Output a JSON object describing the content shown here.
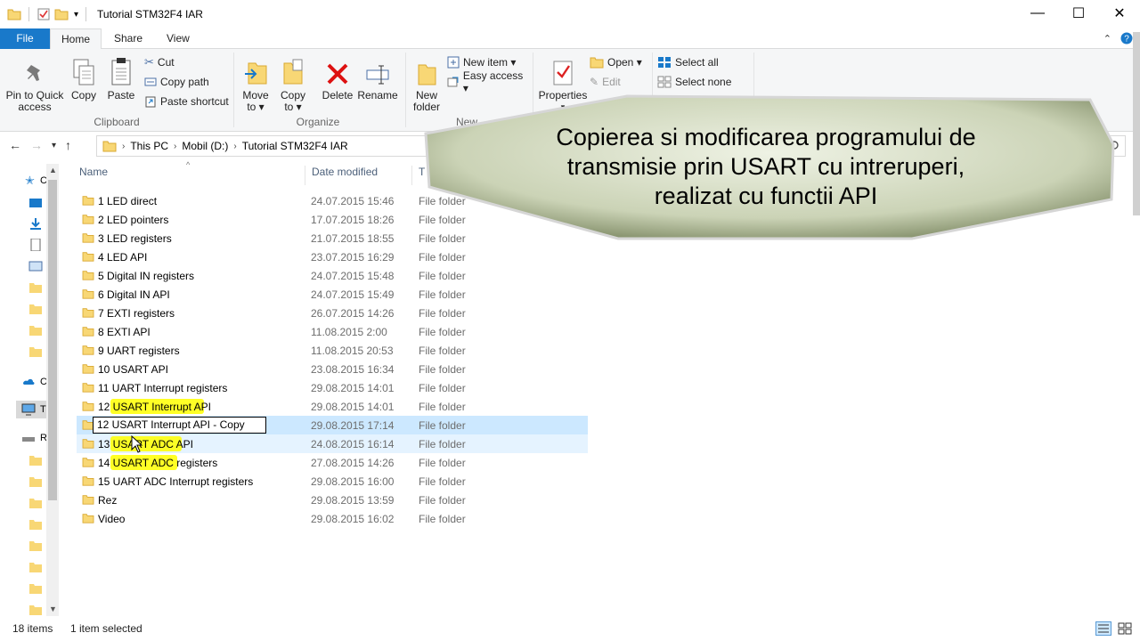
{
  "window": {
    "title": "Tutorial STM32F4 IAR",
    "minimize": "—",
    "maximize": "☐",
    "close": "✕"
  },
  "ribbon_tabs": {
    "file": "File",
    "home": "Home",
    "share": "Share",
    "view": "View"
  },
  "clipboard": {
    "label": "Clipboard",
    "pin_line1": "Pin to Quick",
    "pin_line2": "access",
    "copy": "Copy",
    "paste": "Paste",
    "cut": "Cut",
    "copy_path": "Copy path",
    "paste_shortcut": "Paste shortcut"
  },
  "organize": {
    "label": "Organize",
    "move_to_line1": "Move",
    "move_to_line2": "to ▾",
    "copy_to_line1": "Copy",
    "copy_to_line2": "to ▾",
    "delete": "Delete",
    "rename": "Rename"
  },
  "new_group": {
    "label": "New",
    "new_folder_line1": "New",
    "new_folder_line2": "folder",
    "new_item": "New item ▾",
    "easy_access": "Easy access ▾"
  },
  "open_group": {
    "properties": "Properties",
    "open": "Open ▾",
    "edit": "Edit"
  },
  "select_group": {
    "select_all": "Select all",
    "select_none": "Select none"
  },
  "address": {
    "crumbs": [
      "This PC",
      "Mobil (D:)",
      "Tutorial STM32F4 IAR"
    ]
  },
  "columns": {
    "name": "Name",
    "date_modified": "Date modified",
    "type": "T"
  },
  "files": [
    {
      "name": "1 LED direct",
      "date": "24.07.2015 15:46",
      "type": "File folder"
    },
    {
      "name": "2 LED pointers",
      "date": "17.07.2015 18:26",
      "type": "File folder"
    },
    {
      "name": "3 LED registers",
      "date": "21.07.2015 18:55",
      "type": "File folder"
    },
    {
      "name": "4 LED API",
      "date": "23.07.2015 16:29",
      "type": "File folder"
    },
    {
      "name": "5 Digital IN registers",
      "date": "24.07.2015 15:48",
      "type": "File folder"
    },
    {
      "name": "6 Digital IN API",
      "date": "24.07.2015 15:49",
      "type": "File folder"
    },
    {
      "name": "7 EXTI registers",
      "date": "26.07.2015 14:26",
      "type": "File folder"
    },
    {
      "name": "8 EXTI API",
      "date": "11.08.2015 2:00",
      "type": "File folder"
    },
    {
      "name": "9 UART registers",
      "date": "11.08.2015 20:53",
      "type": "File folder"
    },
    {
      "name": "10 USART API",
      "date": "23.08.2015 16:34",
      "type": "File folder"
    },
    {
      "name": "11 UART Interrupt registers",
      "date": "29.08.2015 14:01",
      "type": "File folder"
    },
    {
      "name": "12 USART Interrupt API",
      "date": "29.08.2015 14:01",
      "type": "File folder"
    },
    {
      "name": "12 USART Interrupt API - Copy",
      "date": "29.08.2015 17:14",
      "type": "File folder"
    },
    {
      "name": "13 USART ADC API",
      "date": "24.08.2015 16:14",
      "type": "File folder"
    },
    {
      "name": "14 USART ADC registers",
      "date": "27.08.2015 14:26",
      "type": "File folder"
    },
    {
      "name": "15 UART ADC Interrupt registers",
      "date": "29.08.2015 16:00",
      "type": "File folder"
    },
    {
      "name": "Rez",
      "date": "29.08.2015 13:59",
      "type": "File folder"
    },
    {
      "name": "Video",
      "date": "29.08.2015 16:02",
      "type": "File folder"
    }
  ],
  "status": {
    "items": "18 items",
    "selected": "1 item selected"
  },
  "banner": {
    "line1": "Copierea si modificarea programului de",
    "line2": "transmisie prin USART cu intreruperi,",
    "line3": "realizat cu functii API"
  },
  "colors": {
    "file_tab": "#1979ca",
    "selection": "#cce8ff",
    "folder": "#f8d775",
    "highlight": "#ffff00"
  }
}
